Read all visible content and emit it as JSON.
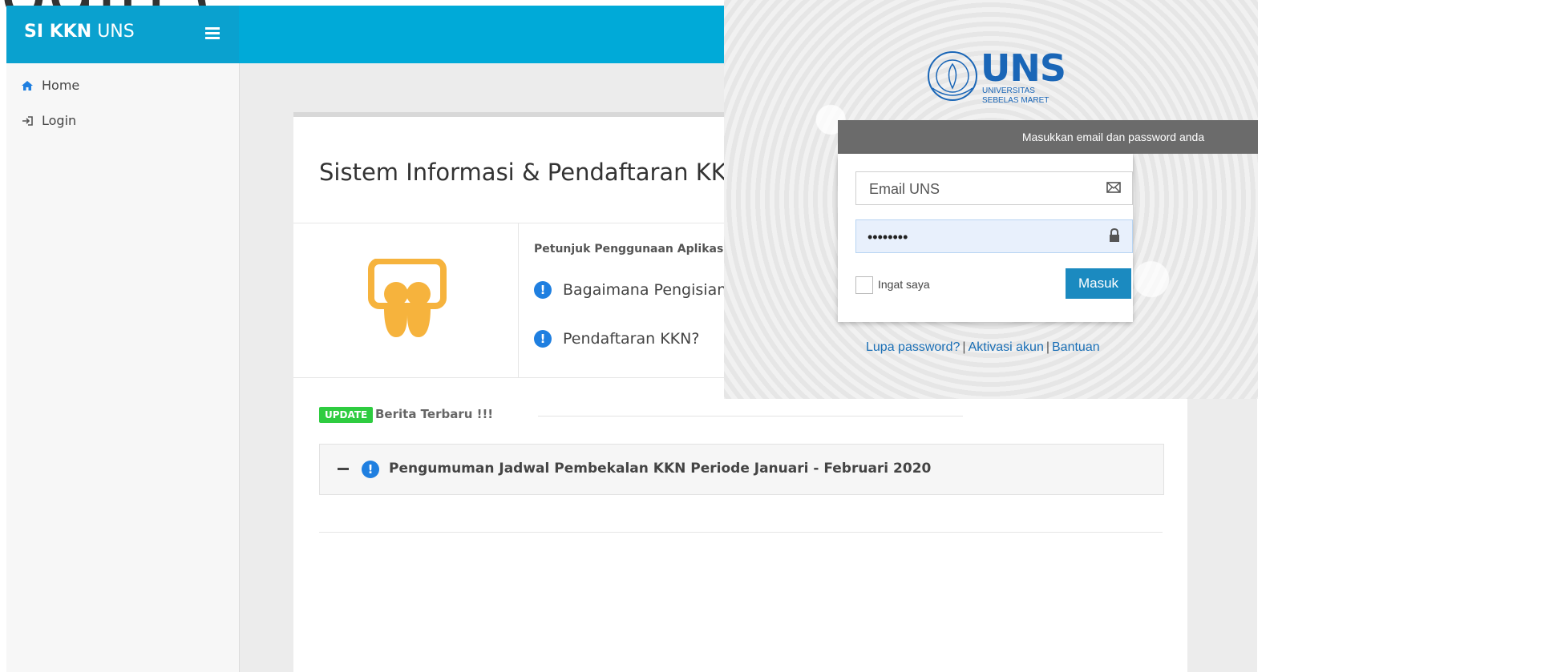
{
  "fragment_text": "ogin (",
  "app": {
    "brand_bold": "SI KKN",
    "brand_rest": "UNS",
    "nav": [
      {
        "label": "Home",
        "icon": "home-icon"
      },
      {
        "label": "Login",
        "icon": "login-icon"
      }
    ],
    "page_title": "Sistem Informasi & Pendaftaran KKN",
    "info_title": "Petunjuk Penggunaan Aplikasi",
    "faq": [
      {
        "text": "Bagaimana Pengisian L"
      },
      {
        "text": "Pendaftaran KKN?"
      }
    ],
    "update_badge": "UPDATE",
    "news_heading": "Berita Terbaru !!!",
    "news_item": "Pengumuman Jadwal Pembekalan KKN Periode Januari - Februari 2020",
    "colors": {
      "topbar": "#00aad8",
      "accent_blue": "#1f7fe0",
      "badge_green": "#2ecc40",
      "icon_yellow": "#f6b33d"
    }
  },
  "login": {
    "logo_text": "UNS",
    "logo_sub1": "UNIVERSITAS",
    "logo_sub2": "SEBELAS MARET",
    "header": "Masukkan email dan password anda",
    "email_placeholder": "Email UNS",
    "password_value": "••••••••",
    "remember_label": "Ingat saya",
    "submit_label": "Masuk",
    "links": [
      "Lupa password?",
      "Aktivasi akun",
      "Bantuan"
    ],
    "colors": {
      "header_bg": "#6b6b6b",
      "button": "#1b8ac0",
      "link": "#1a6fb6"
    }
  }
}
